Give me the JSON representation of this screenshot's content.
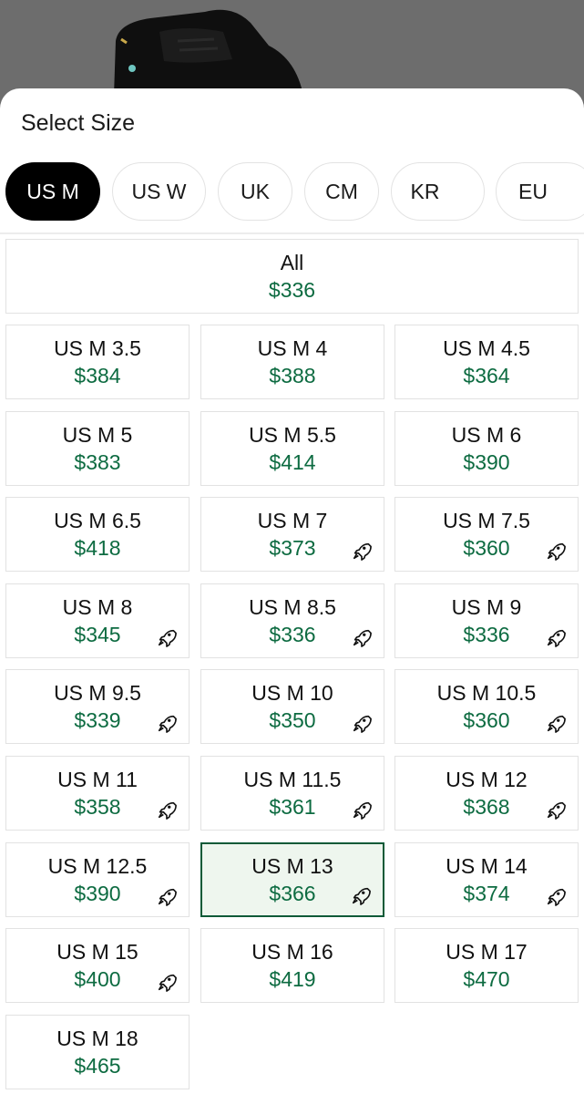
{
  "sheet": {
    "title": "Select Size"
  },
  "tabs": [
    {
      "label": "US M",
      "active": true
    },
    {
      "label": "US W",
      "active": false
    },
    {
      "label": "UK",
      "active": false
    },
    {
      "label": "CM",
      "active": false
    },
    {
      "label": "KR",
      "active": false
    },
    {
      "label": "EU",
      "active": false
    }
  ],
  "all": {
    "label": "All",
    "price": "$336"
  },
  "sizes": [
    {
      "label": "US M 3.5",
      "price": "$384",
      "rocket": false,
      "selected": false
    },
    {
      "label": "US M 4",
      "price": "$388",
      "rocket": false,
      "selected": false
    },
    {
      "label": "US M 4.5",
      "price": "$364",
      "rocket": false,
      "selected": false
    },
    {
      "label": "US M 5",
      "price": "$383",
      "rocket": false,
      "selected": false
    },
    {
      "label": "US M 5.5",
      "price": "$414",
      "rocket": false,
      "selected": false
    },
    {
      "label": "US M 6",
      "price": "$390",
      "rocket": false,
      "selected": false
    },
    {
      "label": "US M 6.5",
      "price": "$418",
      "rocket": false,
      "selected": false
    },
    {
      "label": "US M 7",
      "price": "$373",
      "rocket": true,
      "selected": false
    },
    {
      "label": "US M 7.5",
      "price": "$360",
      "rocket": true,
      "selected": false
    },
    {
      "label": "US M 8",
      "price": "$345",
      "rocket": true,
      "selected": false
    },
    {
      "label": "US M 8.5",
      "price": "$336",
      "rocket": true,
      "selected": false
    },
    {
      "label": "US M 9",
      "price": "$336",
      "rocket": true,
      "selected": false
    },
    {
      "label": "US M 9.5",
      "price": "$339",
      "rocket": true,
      "selected": false
    },
    {
      "label": "US M 10",
      "price": "$350",
      "rocket": true,
      "selected": false
    },
    {
      "label": "US M 10.5",
      "price": "$360",
      "rocket": true,
      "selected": false
    },
    {
      "label": "US M 11",
      "price": "$358",
      "rocket": true,
      "selected": false
    },
    {
      "label": "US M 11.5",
      "price": "$361",
      "rocket": true,
      "selected": false
    },
    {
      "label": "US M 12",
      "price": "$368",
      "rocket": true,
      "selected": false
    },
    {
      "label": "US M 12.5",
      "price": "$390",
      "rocket": true,
      "selected": false
    },
    {
      "label": "US M 13",
      "price": "$366",
      "rocket": true,
      "selected": true
    },
    {
      "label": "US M 14",
      "price": "$374",
      "rocket": true,
      "selected": false
    },
    {
      "label": "US M 15",
      "price": "$400",
      "rocket": true,
      "selected": false
    },
    {
      "label": "US M 16",
      "price": "$419",
      "rocket": false,
      "selected": false
    },
    {
      "label": "US M 17",
      "price": "$470",
      "rocket": false,
      "selected": false
    },
    {
      "label": "US M 18",
      "price": "$465",
      "rocket": false,
      "selected": false
    }
  ],
  "icons": {
    "fast_ship": "rocket-icon",
    "product_image": "sneaker-image"
  },
  "colors": {
    "price": "#0d6b41",
    "selected_border": "#0b5a37",
    "selected_bg": "#eef6ee",
    "active_tab": "#000000"
  }
}
